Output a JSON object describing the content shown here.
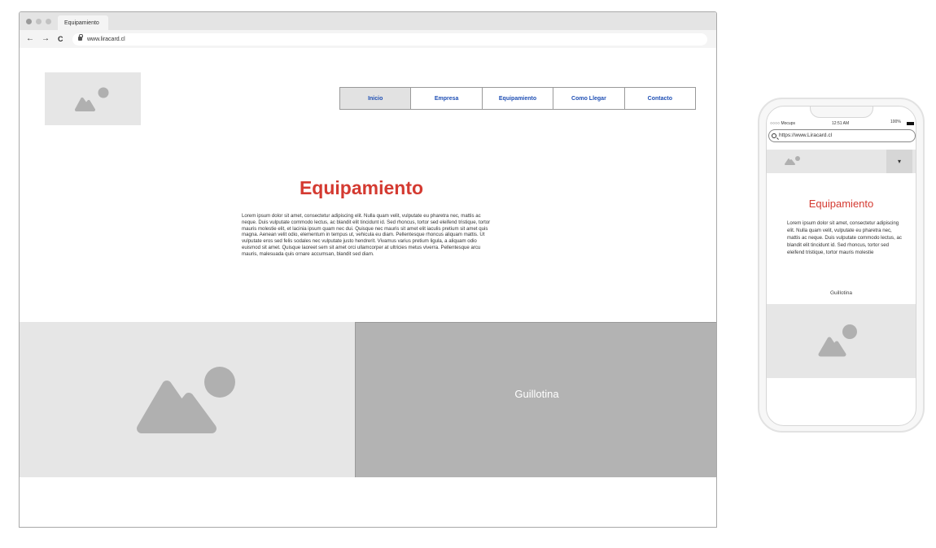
{
  "desktop": {
    "tab_title": "Equipamiento",
    "url": "www.liracard.cl",
    "nav": {
      "back_glyph": "←",
      "forward_glyph": "→",
      "reload_glyph": "C",
      "items": [
        {
          "label": "Inicio",
          "active": true
        },
        {
          "label": "Empresa",
          "active": false
        },
        {
          "label": "Equipamiento",
          "active": false
        },
        {
          "label": "Como Llegar",
          "active": false
        },
        {
          "label": "Contacto",
          "active": false
        }
      ]
    },
    "title": "Equipamiento",
    "body": "Lorem ipsum dolor sit amet, consectetur adipiscing elit. Nulla quam velit, vulputate eu pharetra nec, mattis ac neque. Duis vulputate commodo lectus, ac blandit elit tincidunt id. Sed rhoncus, tortor sed eleifend tristique, tortor mauris molestie elit, et lacinia ipsum quam nec dui. Quisque nec mauris sit amet elit iaculis pretium sit amet quis magna. Aenean velit odio, elementum in tempus ut, vehicula eu diam. Pellentesque rhoncus aliquam mattis. Ut vulputate eros sed felis sodales nec vulputate justo hendrerit. Vivamus varius pretium ligula, a aliquam odio euismod sit amet. Quisque laoreet sem sit amet orci ullamcorper at ultricies metus viverra. Pellentesque arcu mauris, malesuada quis ornare accumsan, blandit sed diam.",
    "panel_label": "Guillotina",
    "icons": [
      "image-placeholder-icon"
    ],
    "colors": {
      "title": "#d43a31",
      "nav_link": "#1f4fb4",
      "panel": "#b3b3b3",
      "placeholder": "#e6e6e6"
    }
  },
  "mobile": {
    "carrier": "○○○○ Mocups",
    "time": "12:51 AM",
    "battery": "100%",
    "url": "https://www.Liracard.cl",
    "menu_glyph": "▾",
    "title": "Equipamiento",
    "body": "Lorem ipsum dolor sit amet, consectetur adipiscing elit. Nulla quam velit, vulputate eu pharetra nec, mattis ac neque. Duis vulputate commodo lectus, ac blandit elit tincidunt id. Sed rhoncus, tortor sed eleifend tristique, tortor mauris molestie",
    "panel_label": "Guillotina"
  }
}
